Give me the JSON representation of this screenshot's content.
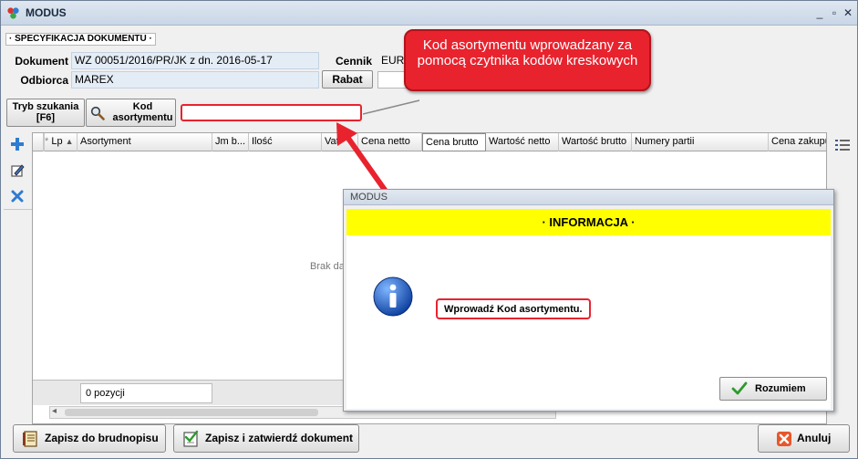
{
  "window": {
    "title": "MODUS",
    "minimize_glyph": "_",
    "maximize_glyph": "▫",
    "close_glyph": "✕"
  },
  "section": {
    "label": "· SPECYFIKACJA DOKUMENTU ·"
  },
  "header": {
    "document_label": "Dokument",
    "document_value": "WZ 00051/2016/PR/JK z dn. 2016-05-17",
    "recipient_label": "Odbiorca",
    "recipient_value": "MAREX",
    "pricelist_label": "Cennik",
    "pricelist_value": "EUR",
    "discount_label": "Rabat",
    "discount_value": ""
  },
  "search": {
    "mode_button_label": "Tryb szukania [F6]",
    "code_button_label": "Kod asortymentu",
    "code_input_value": ""
  },
  "grid": {
    "columns": [
      "",
      "*",
      "Lp",
      "Asortyment",
      "Jm b...",
      "Ilość",
      "Vat",
      "Cena netto",
      "Cena brutto",
      "Wartość netto",
      "Wartość brutto",
      "Numery partii",
      "Cena zakupu"
    ],
    "empty_message": "Brak da",
    "count_label": "0 pozycji"
  },
  "callout": {
    "text": "Kod asortymentu wprowadzany za pomocą czytnika kodów kreskowych",
    "color": "#e8232e"
  },
  "dialog": {
    "title": "MODUS",
    "header": "· INFORMACJA ·",
    "header_color": "#ffff00",
    "message": "Wprowadź Kod asortymentu.",
    "ok_label": "Rozumiem",
    "icon": "info-icon"
  },
  "footer": {
    "draft_label": "Zapisz do brudnopisu",
    "save_confirm_label": "Zapisz i zatwierdź dokument",
    "cancel_label": "Anuluj"
  },
  "icons": [
    "app-icon",
    "add-icon",
    "edit-icon",
    "delete-icon",
    "search-icon",
    "columns-menu-icon",
    "notebook-icon",
    "checklist-icon",
    "cancel-x-icon",
    "checkmark-icon",
    "info-icon"
  ]
}
